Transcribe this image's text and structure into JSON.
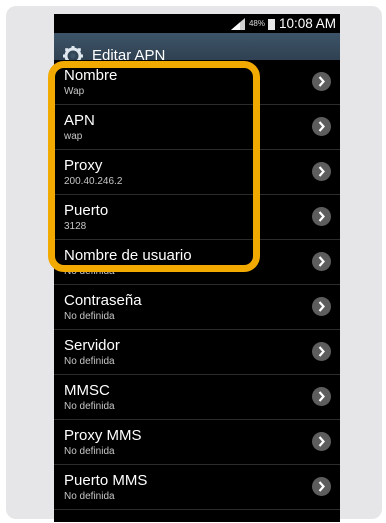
{
  "status_bar": {
    "battery_percent": "48%",
    "time": "10:08 AM",
    "signal_icon": "signal-bars-icon",
    "battery_icon": "battery-icon"
  },
  "action_bar": {
    "icon": "settings-gear-icon",
    "title": "Editar APN"
  },
  "items": [
    {
      "title": "Nombre",
      "value": "Wap"
    },
    {
      "title": "APN",
      "value": "wap"
    },
    {
      "title": "Proxy",
      "value": "200.40.246.2"
    },
    {
      "title": "Puerto",
      "value": "3128"
    },
    {
      "title": "Nombre de usuario",
      "value": "No definida"
    },
    {
      "title": "Contraseña",
      "value": "No definida"
    },
    {
      "title": "Servidor",
      "value": "No definida"
    },
    {
      "title": "MMSC",
      "value": "No definida"
    },
    {
      "title": "Proxy MMS",
      "value": "No definida"
    },
    {
      "title": "Puerto MMS",
      "value": "No definida"
    }
  ],
  "colors": {
    "highlight": "#f2a900",
    "action_bar": "#3d5468",
    "background": "#000000"
  }
}
